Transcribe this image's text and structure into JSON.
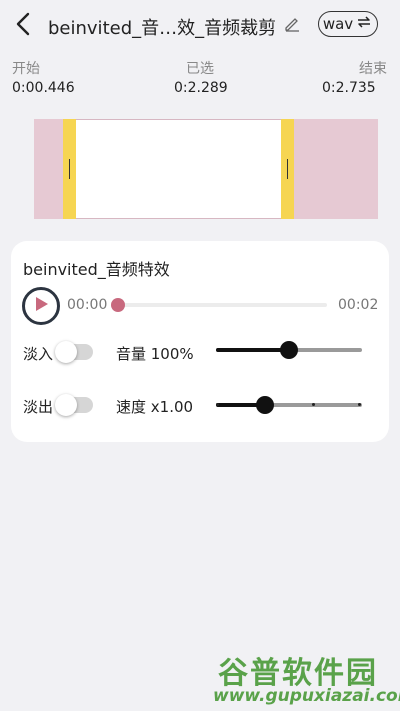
{
  "header": {
    "title": "beinvited_音…效_音频裁剪",
    "format_label": "wav",
    "icons": {
      "back": "chevron-left-icon",
      "edit": "pencil-icon",
      "format": "swap-icon"
    }
  },
  "times": {
    "start": {
      "label": "开始",
      "value": "0:00.446"
    },
    "selected": {
      "label": "已选",
      "value": "0:2.289"
    },
    "end": {
      "label": "结束",
      "value": "0:2.735"
    }
  },
  "waveform": {
    "colors": {
      "unselected": "#e6c9d3",
      "selected": "#ffffff",
      "handle": "#f6d552"
    }
  },
  "player": {
    "file_name": "beinvited_音频特效",
    "current_time": "00:00",
    "total_time": "00:02",
    "progress": 0,
    "colors": {
      "accent": "#c8697e"
    }
  },
  "effects": {
    "fade_in": {
      "label": "淡入",
      "enabled": false
    },
    "fade_out": {
      "label": "淡出",
      "enabled": false
    },
    "volume": {
      "label": "音量 100%",
      "value": 0.5
    },
    "speed": {
      "label": "速度 x1.00",
      "value": 0.33
    }
  },
  "watermark": {
    "main": "谷普软件园",
    "url": "www.gupuxiazai.com"
  }
}
